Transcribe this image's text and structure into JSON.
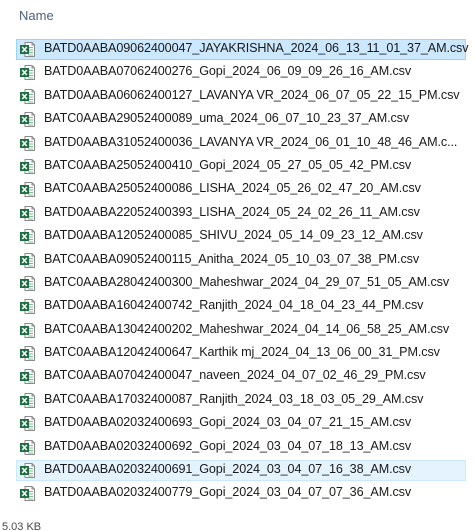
{
  "header": {
    "column_name": "Name"
  },
  "files": [
    "BATD0AABA09062400047_JAYAKRISHNA_2024_06_13_11_01_37_AM.csv",
    "BATD0AABA07062400276_Gopi_2024_06_09_09_26_16_AM.csv",
    "BATD0AABA06062400127_LAVANYA VR_2024_06_07_05_22_15_PM.csv",
    "BATC0AABA29052400089_uma_2024_06_07_10_23_37_AM.csv",
    "BATD0AABA31052400036_LAVANYA VR_2024_06_01_10_48_46_AM.c...",
    "BATC0AABA25052400410_Gopi_2024_05_27_05_05_42_PM.csv",
    "BATC0AABA25052400086_LISHA_2024_05_26_02_47_20_AM.csv",
    "BATD0AABA22052400393_LISHA_2024_05_24_02_26_11_AM.csv",
    "BATD0AABA12052400085_SHIVU_2024_05_14_09_23_12_AM.csv",
    "BATC0AABA09052400115_Anitha_2024_05_10_03_07_38_PM.csv",
    "BATC0AABA28042400300_Maheshwar_2024_04_29_07_51_05_AM.csv",
    "BATD0AABA16042400742_Ranjith_2024_04_18_04_23_44_PM.csv",
    "BATC0AABA13042400202_Maheshwar_2024_04_14_06_58_25_AM.csv",
    "BATC0AABA12042400647_Karthik mj_2024_04_13_06_00_31_PM.csv",
    "BATC0AABA07042400047_naveen_2024_04_07_02_46_29_PM.csv",
    "BATC0AABA17032400087_Ranjith_2024_03_18_03_05_29_AM.csv",
    "BATD0AABA02032400693_Gopi_2024_03_04_07_21_15_AM.csv",
    "BATD0AABA02032400692_Gopi_2024_03_04_07_18_13_AM.csv",
    "BATD0AABA02032400691_Gopi_2024_03_04_07_16_38_AM.csv",
    "BATD0AABA02032400779_Gopi_2024_03_04_07_07_36_AM.csv"
  ],
  "selected_index": 0,
  "focused_index": 18,
  "file_icon": "excel-csv-icon",
  "footer": {
    "status": "5.03 KB"
  },
  "colors": {
    "selection": "#cce8ff",
    "selection_border": "#99d1ff",
    "excel_green": "#1d6f42"
  }
}
